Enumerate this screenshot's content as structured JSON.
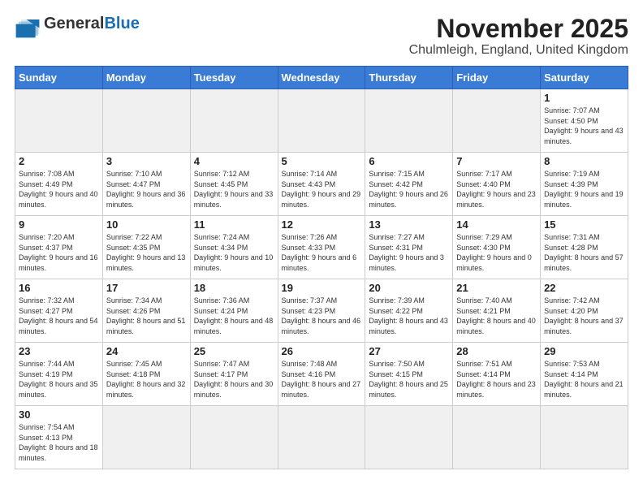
{
  "header": {
    "logo_general": "General",
    "logo_blue": "Blue",
    "title": "November 2025",
    "subtitle": "Chulmleigh, England, United Kingdom"
  },
  "weekdays": [
    "Sunday",
    "Monday",
    "Tuesday",
    "Wednesday",
    "Thursday",
    "Friday",
    "Saturday"
  ],
  "weeks": [
    [
      {
        "day": "",
        "empty": true
      },
      {
        "day": "",
        "empty": true
      },
      {
        "day": "",
        "empty": true
      },
      {
        "day": "",
        "empty": true
      },
      {
        "day": "",
        "empty": true
      },
      {
        "day": "",
        "empty": true
      },
      {
        "day": "1",
        "sunrise": "7:07 AM",
        "sunset": "4:50 PM",
        "daylight": "9 hours and 43 minutes."
      }
    ],
    [
      {
        "day": "2",
        "sunrise": "7:08 AM",
        "sunset": "4:49 PM",
        "daylight": "9 hours and 40 minutes."
      },
      {
        "day": "3",
        "sunrise": "7:10 AM",
        "sunset": "4:47 PM",
        "daylight": "9 hours and 36 minutes."
      },
      {
        "day": "4",
        "sunrise": "7:12 AM",
        "sunset": "4:45 PM",
        "daylight": "9 hours and 33 minutes."
      },
      {
        "day": "5",
        "sunrise": "7:14 AM",
        "sunset": "4:43 PM",
        "daylight": "9 hours and 29 minutes."
      },
      {
        "day": "6",
        "sunrise": "7:15 AM",
        "sunset": "4:42 PM",
        "daylight": "9 hours and 26 minutes."
      },
      {
        "day": "7",
        "sunrise": "7:17 AM",
        "sunset": "4:40 PM",
        "daylight": "9 hours and 23 minutes."
      },
      {
        "day": "8",
        "sunrise": "7:19 AM",
        "sunset": "4:39 PM",
        "daylight": "9 hours and 19 minutes."
      }
    ],
    [
      {
        "day": "9",
        "sunrise": "7:20 AM",
        "sunset": "4:37 PM",
        "daylight": "9 hours and 16 minutes."
      },
      {
        "day": "10",
        "sunrise": "7:22 AM",
        "sunset": "4:35 PM",
        "daylight": "9 hours and 13 minutes."
      },
      {
        "day": "11",
        "sunrise": "7:24 AM",
        "sunset": "4:34 PM",
        "daylight": "9 hours and 10 minutes."
      },
      {
        "day": "12",
        "sunrise": "7:26 AM",
        "sunset": "4:33 PM",
        "daylight": "9 hours and 6 minutes."
      },
      {
        "day": "13",
        "sunrise": "7:27 AM",
        "sunset": "4:31 PM",
        "daylight": "9 hours and 3 minutes."
      },
      {
        "day": "14",
        "sunrise": "7:29 AM",
        "sunset": "4:30 PM",
        "daylight": "9 hours and 0 minutes."
      },
      {
        "day": "15",
        "sunrise": "7:31 AM",
        "sunset": "4:28 PM",
        "daylight": "8 hours and 57 minutes."
      }
    ],
    [
      {
        "day": "16",
        "sunrise": "7:32 AM",
        "sunset": "4:27 PM",
        "daylight": "8 hours and 54 minutes."
      },
      {
        "day": "17",
        "sunrise": "7:34 AM",
        "sunset": "4:26 PM",
        "daylight": "8 hours and 51 minutes."
      },
      {
        "day": "18",
        "sunrise": "7:36 AM",
        "sunset": "4:24 PM",
        "daylight": "8 hours and 48 minutes."
      },
      {
        "day": "19",
        "sunrise": "7:37 AM",
        "sunset": "4:23 PM",
        "daylight": "8 hours and 46 minutes."
      },
      {
        "day": "20",
        "sunrise": "7:39 AM",
        "sunset": "4:22 PM",
        "daylight": "8 hours and 43 minutes."
      },
      {
        "day": "21",
        "sunrise": "7:40 AM",
        "sunset": "4:21 PM",
        "daylight": "8 hours and 40 minutes."
      },
      {
        "day": "22",
        "sunrise": "7:42 AM",
        "sunset": "4:20 PM",
        "daylight": "8 hours and 37 minutes."
      }
    ],
    [
      {
        "day": "23",
        "sunrise": "7:44 AM",
        "sunset": "4:19 PM",
        "daylight": "8 hours and 35 minutes."
      },
      {
        "day": "24",
        "sunrise": "7:45 AM",
        "sunset": "4:18 PM",
        "daylight": "8 hours and 32 minutes."
      },
      {
        "day": "25",
        "sunrise": "7:47 AM",
        "sunset": "4:17 PM",
        "daylight": "8 hours and 30 minutes."
      },
      {
        "day": "26",
        "sunrise": "7:48 AM",
        "sunset": "4:16 PM",
        "daylight": "8 hours and 27 minutes."
      },
      {
        "day": "27",
        "sunrise": "7:50 AM",
        "sunset": "4:15 PM",
        "daylight": "8 hours and 25 minutes."
      },
      {
        "day": "28",
        "sunrise": "7:51 AM",
        "sunset": "4:14 PM",
        "daylight": "8 hours and 23 minutes."
      },
      {
        "day": "29",
        "sunrise": "7:53 AM",
        "sunset": "4:14 PM",
        "daylight": "8 hours and 21 minutes."
      }
    ],
    [
      {
        "day": "30",
        "sunrise": "7:54 AM",
        "sunset": "4:13 PM",
        "daylight": "8 hours and 18 minutes."
      },
      {
        "day": "",
        "empty": true
      },
      {
        "day": "",
        "empty": true
      },
      {
        "day": "",
        "empty": true
      },
      {
        "day": "",
        "empty": true
      },
      {
        "day": "",
        "empty": true
      },
      {
        "day": "",
        "empty": true
      }
    ]
  ]
}
